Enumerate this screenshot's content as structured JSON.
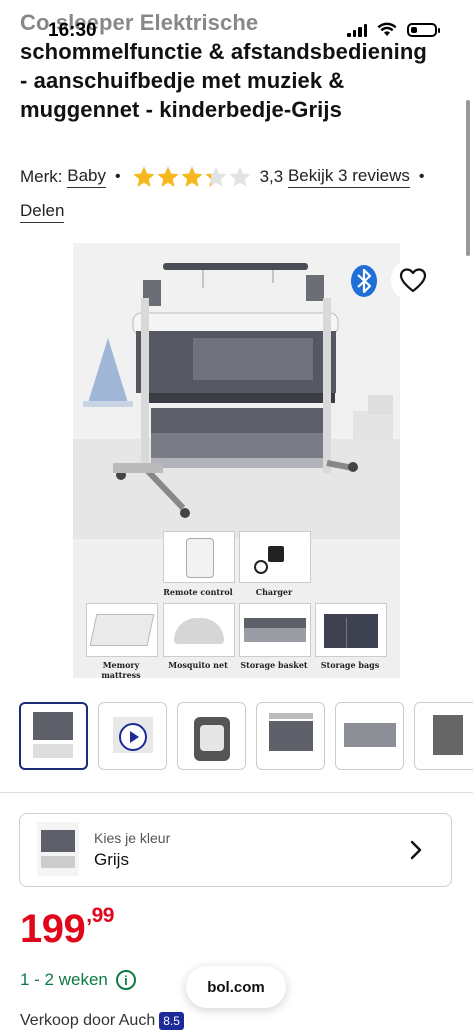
{
  "status_bar": {
    "time": "16:30"
  },
  "product": {
    "title_faded": "Co sleeper Elektrische",
    "title_rest": "schommelfunctie & afstandsbediening - aanschuifbedje met muziek & muggennet - kinderbedje-Grijs",
    "brand_label": "Merk:",
    "brand": "Baby",
    "rating": "3,3",
    "rating_value": 3.3,
    "rating_max": 5,
    "reviews_link": "Bekijk 3 reviews",
    "share": "Delen",
    "accessories": [
      {
        "label": "Remote control"
      },
      {
        "label": "Charger"
      },
      {
        "label": "Memory mattress"
      },
      {
        "label": "Mosquito net"
      },
      {
        "label": "Storage basket"
      },
      {
        "label": "Storage bags"
      }
    ]
  },
  "thumbnails_count": 6,
  "color_selector": {
    "caption": "Kies je kleur",
    "value": "Grijs"
  },
  "price": {
    "euros": "199",
    "cents": ",99"
  },
  "delivery": {
    "text": "1 - 2 weken"
  },
  "seller": {
    "text": "Verkoop door Auch",
    "badge": "8.5"
  },
  "browser": {
    "url": "bol.com"
  },
  "colors": {
    "price": "#e0071b",
    "delivery": "#0f7a45",
    "accent": "#1c2a7a",
    "star": "#f6b81c"
  },
  "icons": [
    "heart-icon",
    "bluetooth-icon",
    "chevron-right-icon",
    "info-icon",
    "play-icon",
    "star-icon"
  ]
}
